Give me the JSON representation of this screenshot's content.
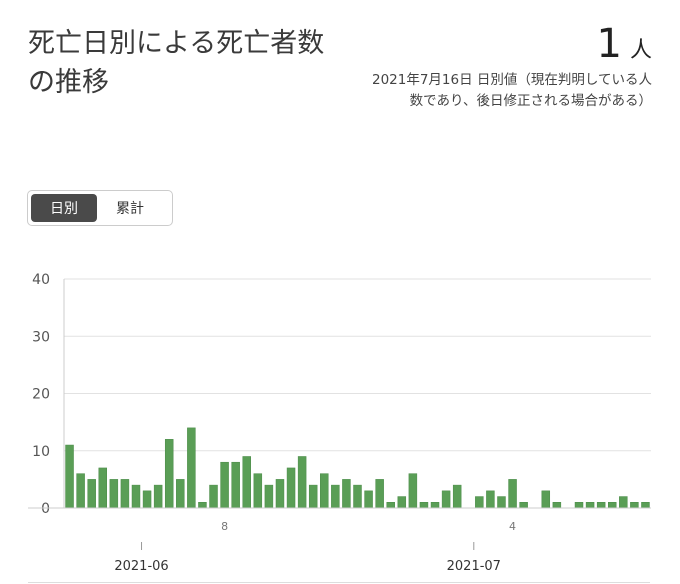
{
  "header": {
    "title": "死亡日別による死亡者数の推移",
    "stat_value": "1",
    "stat_unit": "人",
    "stat_note": "2021年7月16日 日別値（現在判明している人数であり、後日修正される場合がある）"
  },
  "toggle": {
    "daily_label": "日別",
    "cumulative_label": "累計"
  },
  "colors": {
    "bar": "#5a9e56",
    "bar_stroke": "#4a8a47",
    "grid": "#e2e2e2",
    "axis_text": "#555555",
    "toggle_active_bg": "#4a4a4a"
  },
  "chart_data": {
    "type": "bar",
    "x": [
      "2021-05-25",
      "2021-05-26",
      "2021-05-27",
      "2021-05-28",
      "2021-05-29",
      "2021-05-30",
      "2021-05-31",
      "2021-06-01",
      "2021-06-02",
      "2021-06-03",
      "2021-06-04",
      "2021-06-05",
      "2021-06-06",
      "2021-06-07",
      "2021-06-08",
      "2021-06-09",
      "2021-06-10",
      "2021-06-11",
      "2021-06-12",
      "2021-06-13",
      "2021-06-14",
      "2021-06-15",
      "2021-06-16",
      "2021-06-17",
      "2021-06-18",
      "2021-06-19",
      "2021-06-20",
      "2021-06-21",
      "2021-06-22",
      "2021-06-23",
      "2021-06-24",
      "2021-06-25",
      "2021-06-26",
      "2021-06-27",
      "2021-06-28",
      "2021-06-29",
      "2021-06-30",
      "2021-07-01",
      "2021-07-02",
      "2021-07-03",
      "2021-07-04",
      "2021-07-05",
      "2021-07-06",
      "2021-07-07",
      "2021-07-08",
      "2021-07-09",
      "2021-07-10",
      "2021-07-11",
      "2021-07-12",
      "2021-07-13",
      "2021-07-14",
      "2021-07-15",
      "2021-07-16"
    ],
    "values": [
      11,
      6,
      5,
      7,
      5,
      5,
      4,
      3,
      4,
      12,
      5,
      14,
      1,
      4,
      8,
      8,
      9,
      6,
      4,
      5,
      7,
      9,
      4,
      6,
      4,
      5,
      4,
      3,
      5,
      1,
      2,
      6,
      1,
      1,
      3,
      4,
      0,
      2,
      3,
      2,
      5,
      1,
      0,
      3,
      1,
      0,
      1,
      1,
      1,
      1,
      2,
      1,
      1
    ],
    "ylim": [
      0,
      40
    ],
    "yticks": [
      0,
      10,
      20,
      30,
      40
    ],
    "minor_tick_labels": [
      {
        "date": "2021-06-08",
        "label": "8"
      },
      {
        "date": "2021-07-04",
        "label": "4"
      }
    ],
    "month_labels": [
      {
        "date": "2021-06-01",
        "label": "2021-06"
      },
      {
        "date": "2021-07-01",
        "label": "2021-07"
      }
    ],
    "grid": true
  }
}
